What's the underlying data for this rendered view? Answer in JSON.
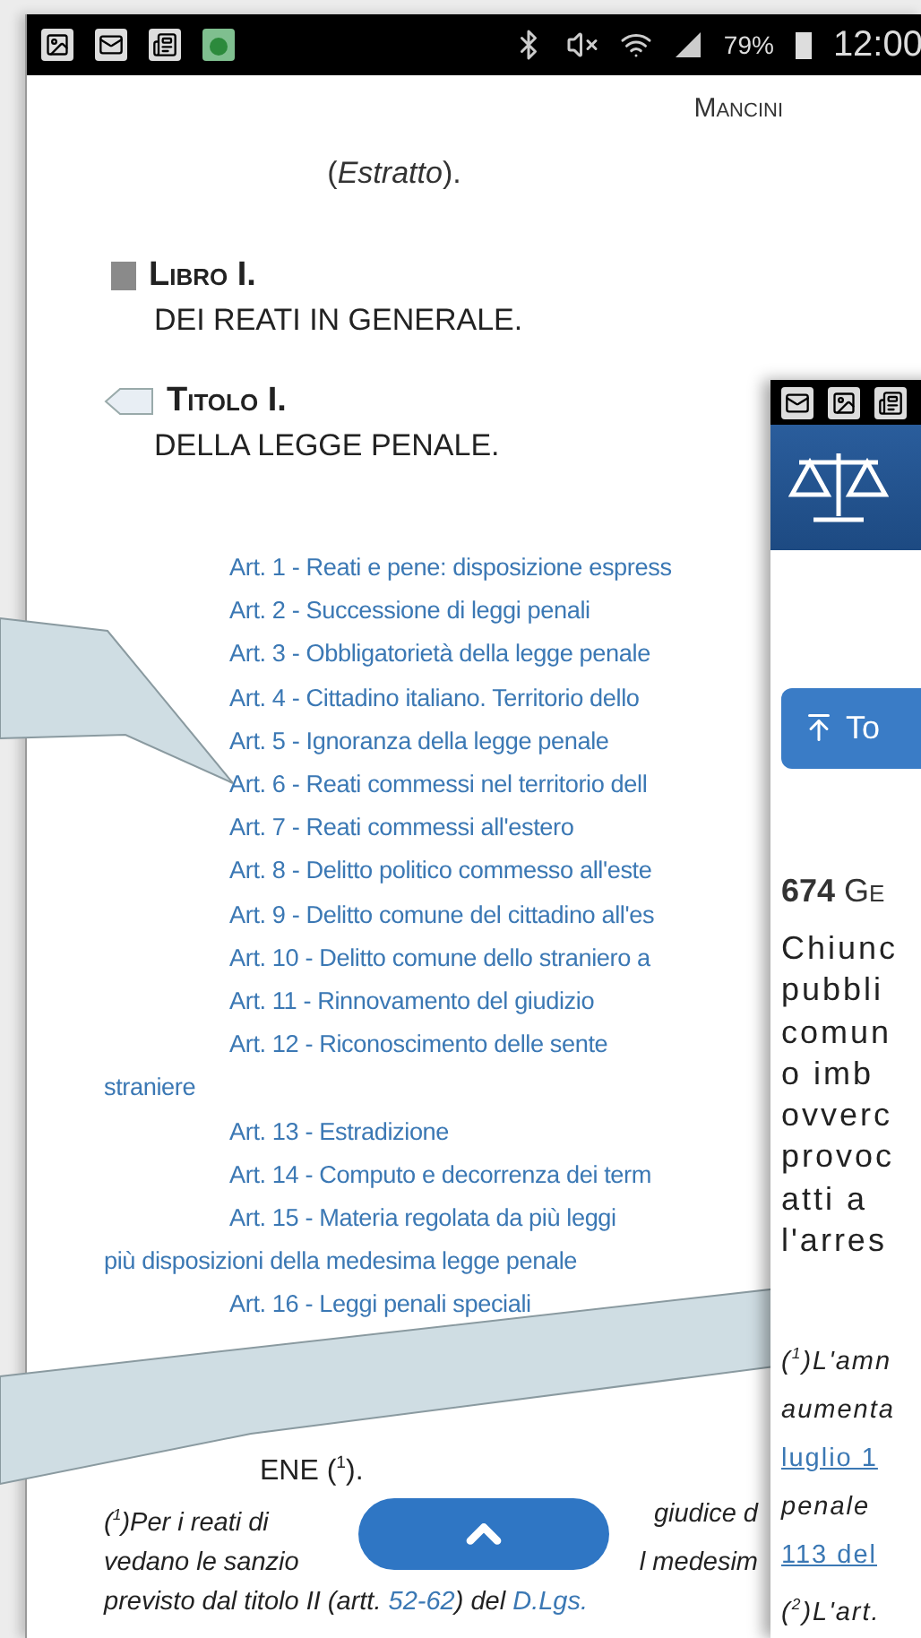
{
  "status_bar": {
    "battery": "79%",
    "time": "12:00"
  },
  "header": {
    "author": "Mancini"
  },
  "note": "(*Estratto*).",
  "book": {
    "label": "Libro I.",
    "title": "DEI REATI IN GENERALE."
  },
  "section": {
    "label": "Titolo I.",
    "title": "DELLA LEGGE PENALE."
  },
  "articles": [
    {
      "text": "Art. 1 - Reati e pene: disposizione espress"
    },
    {
      "text": "Art. 2 - Successione di leggi penali"
    },
    {
      "text": "Art. 3 - Obbligatorietà della legge penale"
    },
    {
      "text": "Art. 4 - Cittadino italiano. Territorio dello"
    },
    {
      "text": "Art. 5 - Ignoranza della legge penale"
    },
    {
      "text": "Art. 6 - Reati commessi nel territorio dell"
    },
    {
      "text": "Art. 7 - Reati commessi all'estero"
    },
    {
      "text": "Art. 8 - Delitto politico commesso all'este"
    },
    {
      "text": "Art. 9 - Delitto comune del cittadino all'es"
    },
    {
      "text": "Art. 10 - Delitto comune dello straniero a"
    },
    {
      "text": "Art. 11 - Rinnovamento del giudizio"
    },
    {
      "text": "Art. 12 - Riconoscimento delle sente",
      "continuation": "straniere"
    },
    {
      "text": "Art. 13 - Estradizione"
    },
    {
      "text": "Art. 14 - Computo e decorrenza dei term"
    },
    {
      "text": "Art. 15 - Materia regolata da più leggi",
      "continuation": "più disposizioni della medesima legge penale"
    },
    {
      "text": "Art. 16 - Leggi penali speciali"
    }
  ],
  "chapter_heading": "ENE ($^{1}$).",
  "footnote": {
    "lines": [
      {
        "left": "($^{1}$)Per i reati di",
        "right": "giudice d"
      },
      {
        "left": "vedano le sanzio",
        "right": "l medesim"
      }
    ],
    "tail": [
      {
        "text": "previsto dal titolo II (artt. ",
        "link": false
      },
      {
        "text": "52-62",
        "link": true
      },
      {
        "text": ") del ",
        "link": false
      },
      {
        "text": "D.Lgs.",
        "link": true
      }
    ]
  },
  "overlay": {
    "button": "To",
    "heading": "**674** Ge",
    "body_lines": [
      "Chiunc",
      "pubbli",
      "comun",
      "o imb",
      "ovverc",
      "provoc",
      "atti a",
      "l'arres"
    ],
    "notes": [
      {
        "text": "($^{1}$)L'amn",
        "kind": "italic"
      },
      {
        "text": "aumenta",
        "kind": "italic"
      },
      {
        "text": "luglio 1",
        "kind": "link"
      },
      {
        "text": "penale",
        "kind": "italic"
      },
      {
        "text": "113 del",
        "kind": "link"
      },
      {
        "text": "($^{2}$)L'art.",
        "kind": "italic"
      }
    ]
  }
}
